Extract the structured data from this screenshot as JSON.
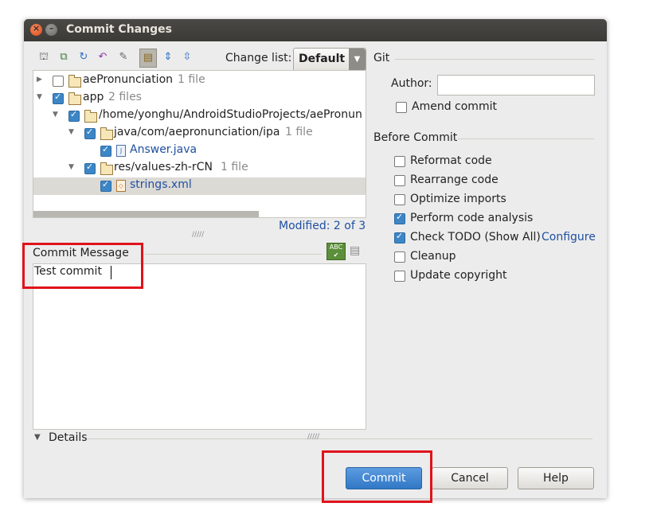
{
  "window": {
    "title": "Commit Changes"
  },
  "toolbar": {
    "icons": [
      "revert-icon",
      "move-icon",
      "refresh-icon",
      "undo-icon",
      "diff-icon",
      "group-by-directory-icon",
      "expand-all-icon",
      "collapse-all-icon"
    ],
    "change_list_label": "Change list:",
    "change_list_value": "Default"
  },
  "tree": {
    "rows": [
      {
        "name": "aePronunciation",
        "meta": "1 file",
        "checked": false
      },
      {
        "name": "app",
        "meta": "2 files",
        "checked": true
      },
      {
        "name": "/home/yonghu/AndroidStudioProjects/aePronun",
        "meta": "",
        "checked": true
      },
      {
        "name": "java/com/aepronunciation/ipa",
        "meta": "1 file",
        "checked": true
      },
      {
        "name": "Answer.java",
        "meta": "",
        "checked": true
      },
      {
        "name": "res/values-zh-rCN",
        "meta": "1 file",
        "checked": true
      },
      {
        "name": "strings.xml",
        "meta": "",
        "checked": true
      }
    ],
    "modified": "Modified: 2 of 3"
  },
  "commit_message": {
    "label": "Commit Message",
    "text": "Test commit"
  },
  "details": {
    "label": "Details"
  },
  "git": {
    "section": "Git",
    "author_label": "Author:",
    "author_value": "",
    "amend_label": "Amend commit"
  },
  "before_commit": {
    "section": "Before Commit",
    "options": [
      {
        "label": "Reformat code",
        "checked": false
      },
      {
        "label": "Rearrange code",
        "checked": false
      },
      {
        "label": "Optimize imports",
        "checked": false
      },
      {
        "label": "Perform code analysis",
        "checked": true
      },
      {
        "label": "Check TODO (Show All)",
        "checked": true
      },
      {
        "label": "Cleanup",
        "checked": false
      },
      {
        "label": "Update copyright",
        "checked": false
      }
    ],
    "configure_link": "Configure"
  },
  "buttons": {
    "commit": "Commit",
    "cancel": "Cancel",
    "help": "Help"
  },
  "colors": {
    "accent": "#3178c6",
    "highlight": "#e0121b",
    "link": "#1f4fa1"
  }
}
